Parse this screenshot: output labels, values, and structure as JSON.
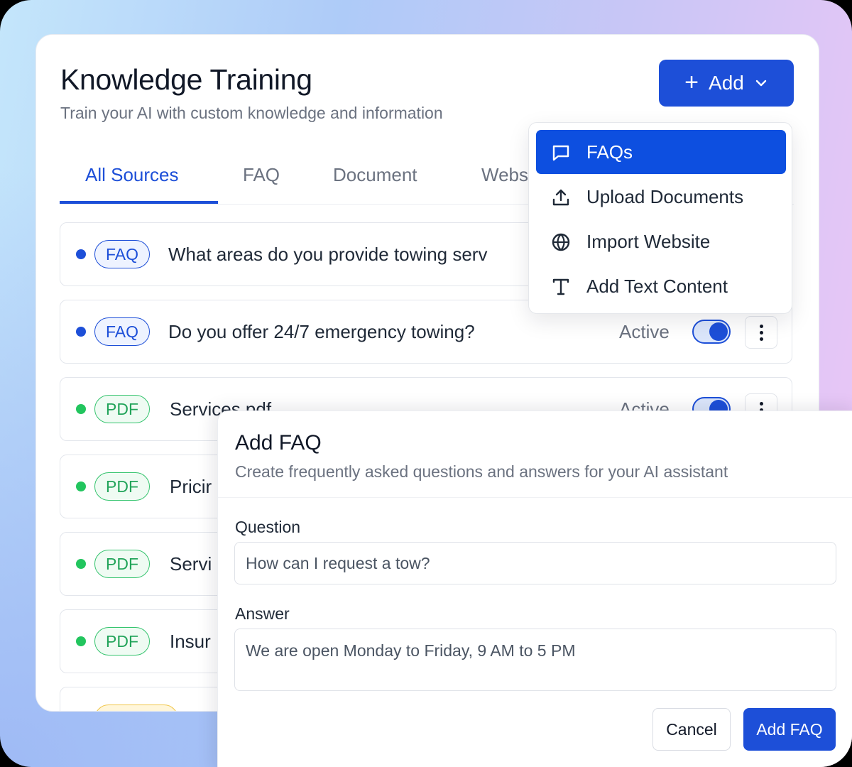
{
  "header": {
    "title": "Knowledge Training",
    "subtitle": "Train your AI with custom knowledge and information",
    "add_button": {
      "icon": "plus-icon",
      "label": "Add",
      "chevron": "chevron-down-icon"
    }
  },
  "tabs": [
    {
      "label": "All Sources",
      "active": true
    },
    {
      "label": "FAQ",
      "active": false
    },
    {
      "label": "Document",
      "active": false
    },
    {
      "label": "Webs",
      "active": false
    }
  ],
  "dropdown": {
    "items": [
      {
        "label": "FAQs",
        "icon": "message-square-icon",
        "selected": true
      },
      {
        "label": "Upload Documents",
        "icon": "upload-icon",
        "selected": false
      },
      {
        "label": "Import Website",
        "icon": "globe-icon",
        "selected": false
      },
      {
        "label": "Add Text Content",
        "icon": "text-type-icon",
        "selected": false
      }
    ]
  },
  "sources": [
    {
      "type": "FAQ",
      "text": "What areas do you provide towing serv",
      "status": "",
      "dot_color": "#1d4fd8"
    },
    {
      "type": "FAQ",
      "text": "Do you offer 24/7 emergency towing?",
      "status": "Active",
      "dot_color": "#1d4fd8"
    },
    {
      "type": "PDF",
      "text": "Services.pdf",
      "status": "Active",
      "dot_color": "#22c55e"
    },
    {
      "type": "PDF",
      "text": "Pricir",
      "status": "",
      "dot_color": "#22c55e"
    },
    {
      "type": "PDF",
      "text": "Servi",
      "status": "",
      "dot_color": "#22c55e"
    },
    {
      "type": "PDF",
      "text": "Insur",
      "status": "",
      "dot_color": "#22c55e"
    }
  ],
  "modal": {
    "title": "Add FAQ",
    "subtitle": "Create frequently asked questions and answers for your AI assistant",
    "question_label": "Question",
    "question_value": "How can I request a tow?",
    "answer_label": "Answer",
    "answer_value": "We are open Monday to Friday, 9 AM to 5 PM",
    "cancel_label": "Cancel",
    "submit_label": "Add FAQ"
  },
  "colors": {
    "primary": "#1d4fd8",
    "pdf_green": "#22c55e",
    "muted_text": "#6b7280"
  }
}
